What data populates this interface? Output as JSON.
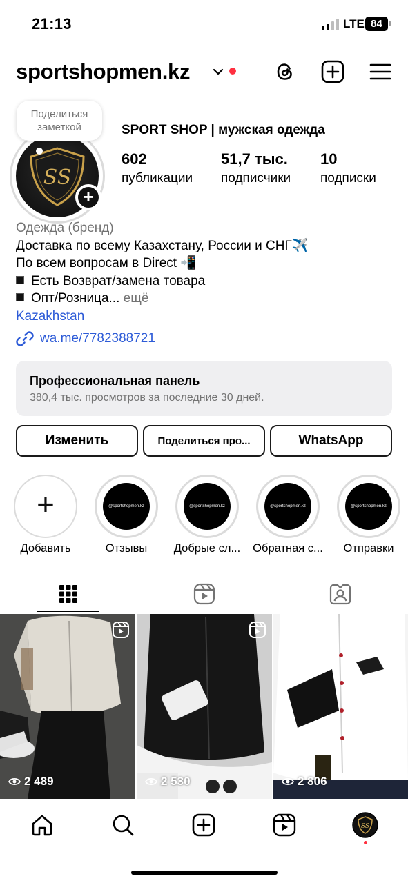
{
  "status_bar": {
    "time": "21:13",
    "network": "LTE",
    "battery": "84"
  },
  "header": {
    "username": "sportshopmen.kz"
  },
  "profile": {
    "note": "Поделиться заметкой",
    "avatar_text": "SS",
    "display_name": "SPORT SHOP | мужская одежда",
    "stats": [
      {
        "value": "602",
        "label": "публикации"
      },
      {
        "value": "51,7 тыс.",
        "label": "подписчики"
      },
      {
        "value": "10",
        "label": "подписки"
      }
    ],
    "bio": {
      "category": "Одежда (бренд)",
      "line1": "Доставка по всему Казахстану, России и СНГ✈️",
      "line2": "По всем вопросам в Direct 📲",
      "line3": "Есть Возврат/замена товара",
      "line4": "Опт/Розница...",
      "more": " ещё",
      "location": "Kazakhstan",
      "link": "wa.me/7782388721"
    }
  },
  "pro_panel": {
    "title": "Профессиональная панель",
    "subtitle": "380,4 тыс. просмотров за последние 30 дней."
  },
  "buttons": {
    "edit": "Изменить",
    "share": "Поделиться про...",
    "whatsapp": "WhatsApp"
  },
  "highlights": {
    "add_label": "Добавить",
    "cover_text": "@sportshopmen.kz",
    "items": [
      {
        "label": "Отзывы"
      },
      {
        "label": "Добрые сл..."
      },
      {
        "label": "Обратная с..."
      },
      {
        "label": "Отправки"
      }
    ]
  },
  "posts": [
    {
      "views": "2 489"
    },
    {
      "views": "2 530"
    },
    {
      "views": "2 806"
    }
  ],
  "colors": {
    "accent": "#2d5bd7",
    "notification": "#ff3040",
    "panel_bg": "#efeff1"
  }
}
